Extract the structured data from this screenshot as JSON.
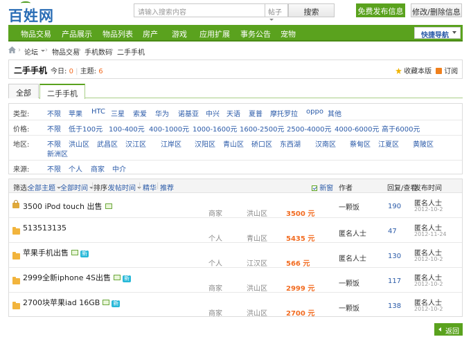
{
  "header": {
    "logo": "百姓网",
    "search_placeholder": "请输入搜索内容",
    "search_type": "帖子",
    "search_button": "搜索",
    "free_post": "免费发布信息",
    "edit_delete": "修改/删除信息"
  },
  "nav": {
    "items": [
      "物品交易",
      "产品展示",
      "物品列表",
      "房产",
      "游戏",
      "应用扩展",
      "事务公告",
      "宠物"
    ],
    "quick_nav": "快捷导航"
  },
  "breadcrumb": [
    "论坛",
    "物品交易",
    "手机数码",
    "二手手机"
  ],
  "forum": {
    "title": "二手手机",
    "today_label": "今日:",
    "today_count": "0",
    "sep": "|",
    "topics_label": "主题:",
    "topics_count": "6",
    "fav": "收藏本版",
    "subscribe": "订阅"
  },
  "tabs": [
    "全部",
    "二手手机"
  ],
  "filters": {
    "type": {
      "label": "类型:",
      "options": [
        "不限",
        "苹果",
        "HTC",
        "三星",
        "索爱",
        "华为",
        "诺基亚",
        "中兴",
        "天语",
        "夏普",
        "摩托罗拉",
        "oppo",
        "其他"
      ]
    },
    "price": {
      "label": "价格:",
      "options": [
        "不限",
        "低于100元",
        "100-400元",
        "400-1000元",
        "1000-1600元",
        "1600-2500元",
        "2500-4000元",
        "4000-6000元",
        "高于6000元"
      ]
    },
    "area": {
      "label": "地区:",
      "options": [
        "不限",
        "洪山区",
        "武昌区",
        "汉江区",
        "江岸区",
        "汉阳区",
        "青山区",
        "硚口区",
        "东西湖",
        "汉南区",
        "蔡甸区",
        "江夏区",
        "黄陂区",
        "新洲区"
      ]
    },
    "source": {
      "label": "来源:",
      "options": [
        "不限",
        "个人",
        "商家",
        "中介"
      ]
    }
  },
  "thead": {
    "filter_label": "筛选:",
    "all_topics": "全部主题",
    "all_time": "全部时间",
    "sort_label": "排序:",
    "sort_value": "发帖时间",
    "digest": "精华",
    "recommend": "推荐",
    "new_window": "新窗",
    "author": "作者",
    "replies_views": "回复/查看",
    "post_time": "发布时间"
  },
  "threads": [
    {
      "title": "3500 iPod touch 出售",
      "img": true,
      "new": false,
      "source": "商家",
      "area": "洪山区",
      "price": "3500 元",
      "author": "一颗饭",
      "replies": "190",
      "poster": "匿名人士",
      "date": "2012-10-2",
      "locked": true
    },
    {
      "title": "513513135",
      "img": false,
      "new": false,
      "source": "个人",
      "area": "青山区",
      "price": "5435 元",
      "author": "匿名人士",
      "replies": "47",
      "poster": "匿名人士",
      "date": "2012-11-24",
      "locked": false
    },
    {
      "title": "苹果手机出售",
      "img": true,
      "new": true,
      "source": "个人",
      "area": "江汉区",
      "price": "566 元",
      "author": "匿名人士",
      "replies": "130",
      "poster": "匿名人士",
      "date": "2012-10-2",
      "locked": false
    },
    {
      "title": "2999全新iphone 4S出售",
      "img": true,
      "new": true,
      "source": "商家",
      "area": "洪山区",
      "price": "2999 元",
      "author": "一颗饭",
      "replies": "117",
      "poster": "匿名人士",
      "date": "2012-10-2",
      "locked": false
    },
    {
      "title": "2700块苹果iad 16GB",
      "img": true,
      "new": true,
      "source": "商家",
      "area": "洪山区",
      "price": "2700 元",
      "author": "一颗饭",
      "replies": "138",
      "poster": "匿名人士",
      "date": "2012-10-2",
      "locked": false
    }
  ],
  "new_badge": "新",
  "back_button": "返回",
  "colors": {
    "brand_green": "#5aa21e",
    "link_blue": "#2a5aa8",
    "price_orange": "#f26c21"
  }
}
